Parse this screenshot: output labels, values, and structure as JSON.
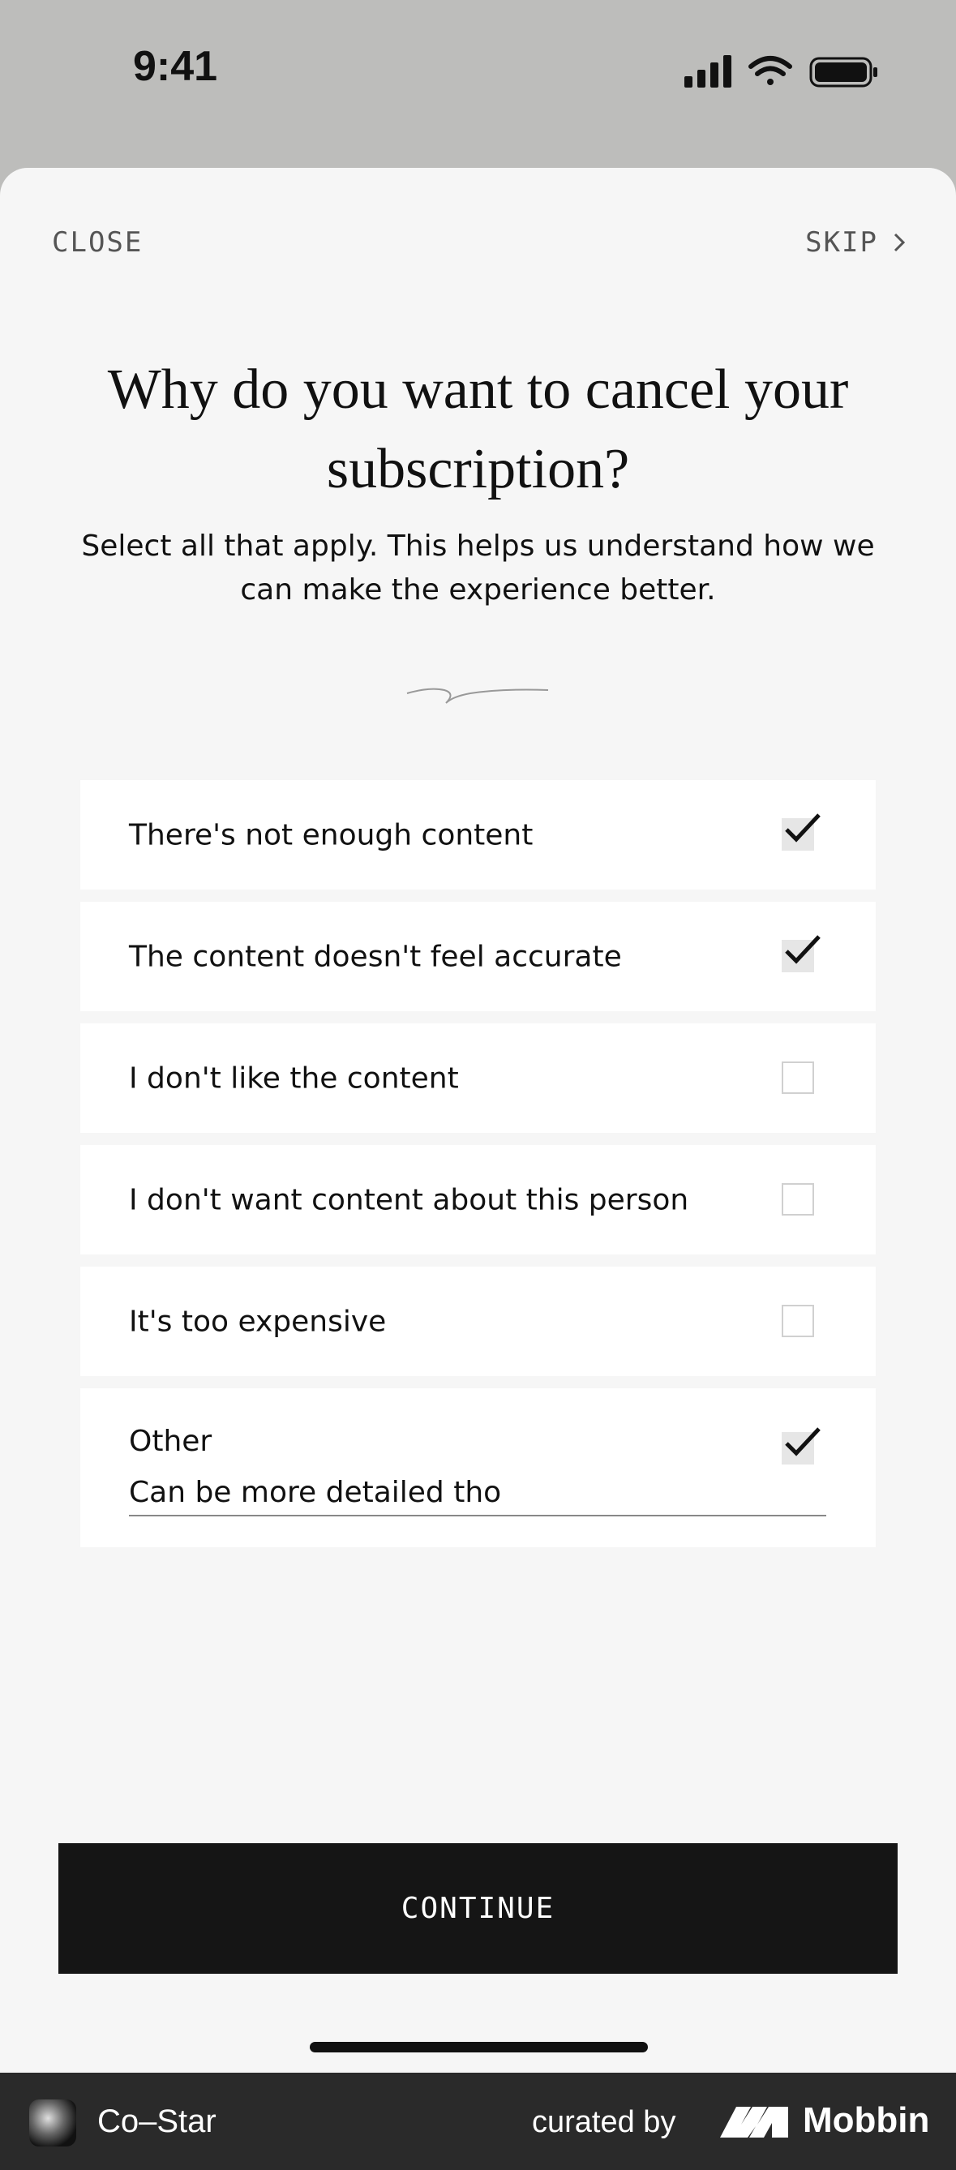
{
  "status_bar": {
    "time": "9:41"
  },
  "header": {
    "close_label": "CLOSE",
    "skip_label": "SKIP"
  },
  "title": "Why do you want to cancel your subscription?",
  "subtitle": "Select all that apply. This helps us understand how we can make the experience better.",
  "options": [
    {
      "label": "There's not enough content",
      "checked": true
    },
    {
      "label": "The content doesn't feel accurate",
      "checked": true
    },
    {
      "label": "I don't like the content",
      "checked": false
    },
    {
      "label": "I don't want content about this person",
      "checked": false
    },
    {
      "label": "It's too expensive",
      "checked": false
    }
  ],
  "other": {
    "label": "Other",
    "checked": true,
    "value": "Can be more detailed tho"
  },
  "continue_label": "CONTINUE",
  "footer": {
    "app_name": "Co–Star",
    "curated_by": "curated by",
    "brand": "Mobbin"
  },
  "icons": [
    "signal-icon",
    "wifi-icon",
    "battery-icon",
    "chevron-right-icon",
    "checkmark-icon",
    "squiggle-icon"
  ]
}
